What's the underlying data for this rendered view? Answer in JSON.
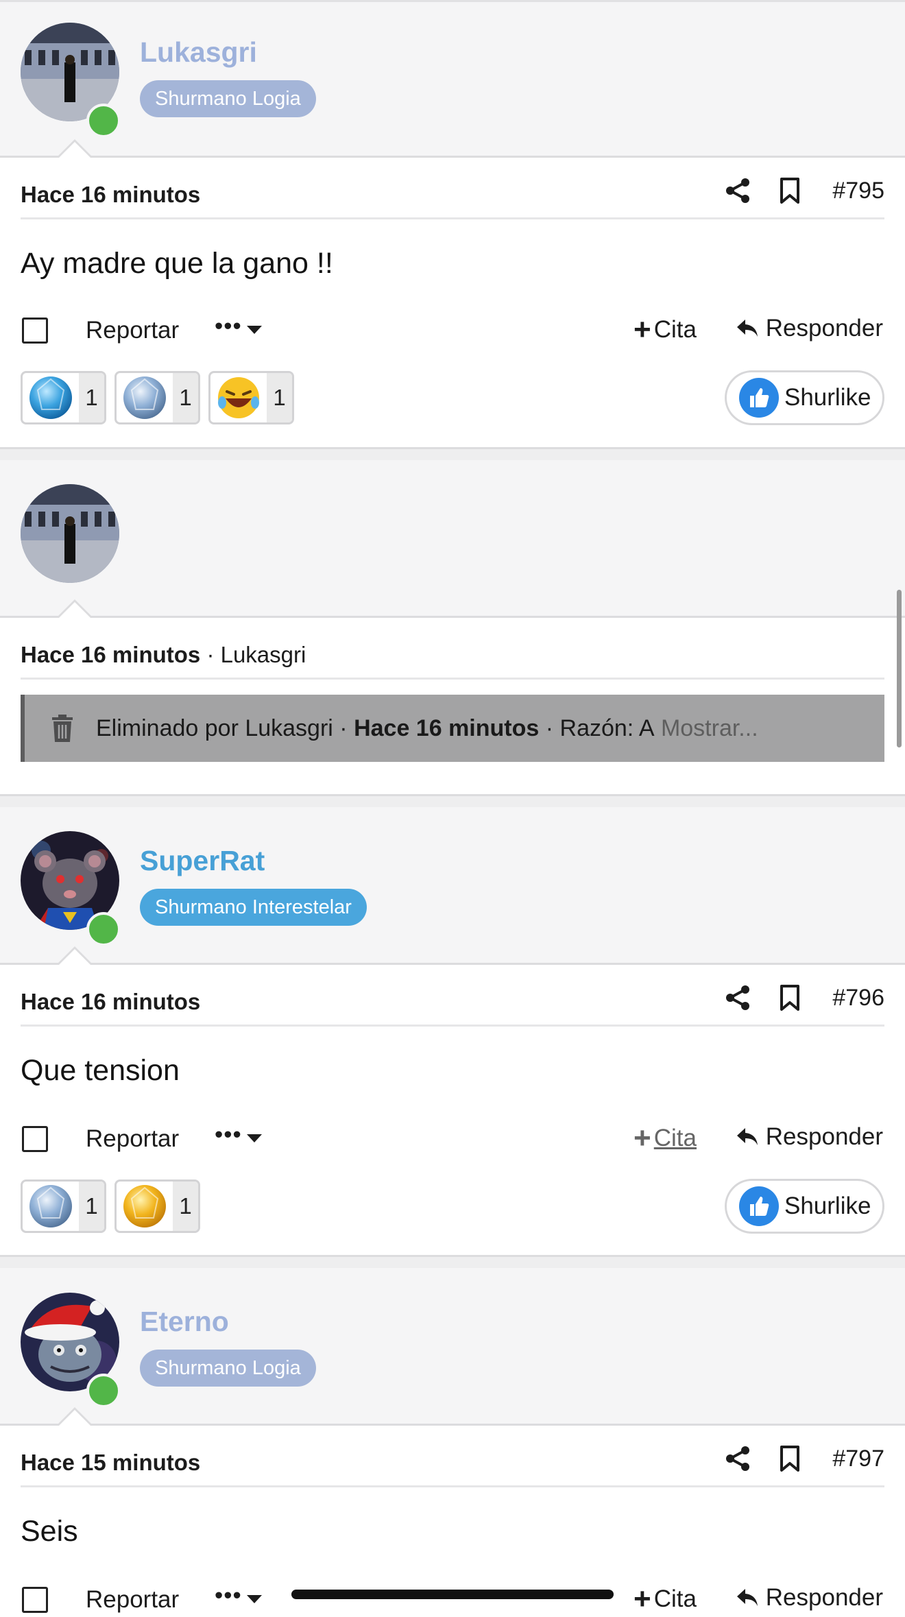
{
  "colors": {
    "logia": "#a4b5d8",
    "logia_name": "#9db1db",
    "interestelar": "#4aa6dd",
    "interestelar_name": "#47a0d6"
  },
  "posts": [
    {
      "username": "Lukasgri",
      "user_title": "Shurmano Logia",
      "date": "Hace 16 minutos",
      "post_number": "#795",
      "message": "Ay madre que la gano !!",
      "actions": {
        "report": "Reportar",
        "more": "•••",
        "quote": "Cita",
        "reply": "Responder"
      },
      "reactions": [
        {
          "icon": "blue-gem-icon",
          "count": "1"
        },
        {
          "icon": "silver-gem-icon",
          "count": "1"
        },
        {
          "icon": "laughing-emoji-icon",
          "count": "1"
        }
      ],
      "like_label": "Shurlike"
    },
    {
      "deleted": true,
      "date": "Hace 16 minutos",
      "author": "· Lukasgri",
      "deleted_by": "Eliminado por Lukasgri ·",
      "deleted_when": "Hace 16 minutos",
      "reason": "· Razón: A",
      "show": "Mostrar..."
    },
    {
      "username": "SuperRat",
      "user_title": "Shurmano Interestelar",
      "date": "Hace 16 minutos",
      "post_number": "#796",
      "message": "Que tension",
      "actions": {
        "report": "Reportar",
        "more": "•••",
        "quote": "Cita",
        "reply": "Responder"
      },
      "reactions": [
        {
          "icon": "silver-gem-icon",
          "count": "1"
        },
        {
          "icon": "gold-gem-icon",
          "count": "1"
        }
      ],
      "like_label": "Shurlike"
    },
    {
      "username": "Eterno",
      "user_title": "Shurmano Logia",
      "date": "Hace 15 minutos",
      "post_number": "#797",
      "message": "Seis",
      "actions": {
        "report": "Reportar",
        "more": "•••",
        "quote": "Cita",
        "reply": "Responder"
      }
    }
  ]
}
